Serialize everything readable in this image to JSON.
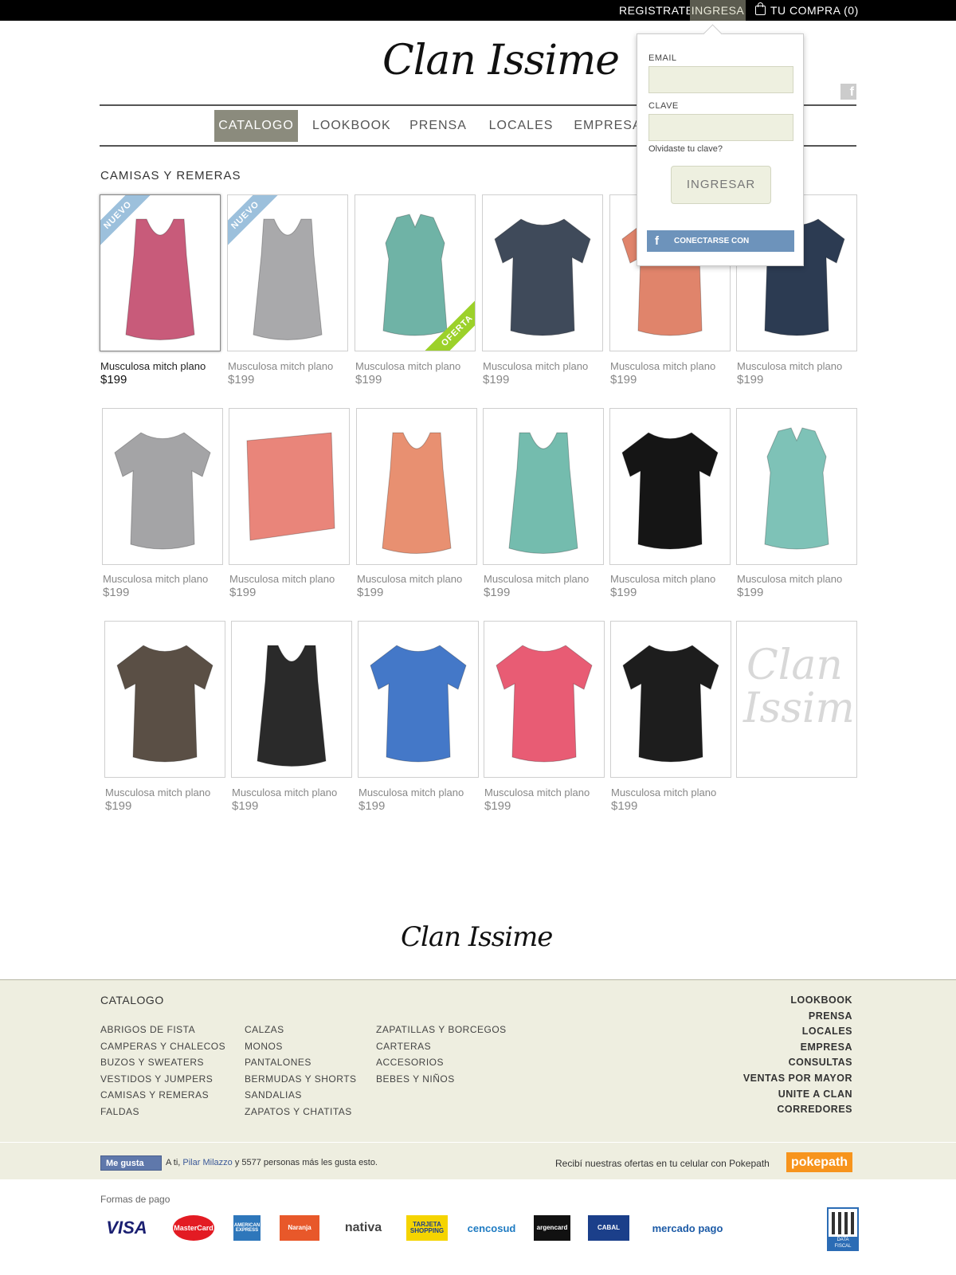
{
  "topbar": {
    "register": "REGISTRATE",
    "login": "INGRESA",
    "cart": "TU COMPRA (0)"
  },
  "logo": "Clan Issime",
  "nav": [
    "CATALOGO",
    "LOOKBOOK",
    "PRENSA",
    "LOCALES",
    "EMPRESA"
  ],
  "section_title": "CAMISAS Y REMERAS",
  "products": [
    {
      "name": "Musculosa mitch plano",
      "price": "$199",
      "badge": "NUEVO",
      "color": "#c85b7a",
      "shape": "tank"
    },
    {
      "name": "Musculosa mitch plano",
      "price": "$199",
      "badge": "NUEVO",
      "color": "#a9a9ab",
      "shape": "tank"
    },
    {
      "name": "Musculosa mitch plano",
      "price": "$199",
      "badge": "OFERTA",
      "color": "#6fb3a6",
      "shape": "sleeveless"
    },
    {
      "name": "Musculosa mitch plano",
      "price": "$199",
      "badge": "",
      "color": "#3f4a5a",
      "shape": "tee"
    },
    {
      "name": "Musculosa mitch plano",
      "price": "$199",
      "badge": "",
      "color": "#e0846b",
      "shape": "tee"
    },
    {
      "name": "Musculosa mitch plano",
      "price": "$199",
      "badge": "",
      "color": "#2c3b52",
      "shape": "tee"
    },
    {
      "name": "Musculosa mitch plano",
      "price": "$199",
      "badge": "",
      "color": "#a4a4a6",
      "shape": "tee"
    },
    {
      "name": "Musculosa mitch plano",
      "price": "$199",
      "badge": "",
      "color": "#e9857a",
      "shape": "folded"
    },
    {
      "name": "Musculosa mitch plano",
      "price": "$199",
      "badge": "",
      "color": "#e89071",
      "shape": "tank"
    },
    {
      "name": "Musculosa mitch plano",
      "price": "$199",
      "badge": "",
      "color": "#74bcae",
      "shape": "tank"
    },
    {
      "name": "Musculosa mitch plano",
      "price": "$199",
      "badge": "",
      "color": "#151515",
      "shape": "tee"
    },
    {
      "name": "Musculosa mitch plano",
      "price": "$199",
      "badge": "",
      "color": "#7ec2b7",
      "shape": "sleeveless"
    },
    {
      "name": "Musculosa mitch plano",
      "price": "$199",
      "badge": "",
      "color": "#5a4f45",
      "shape": "tee"
    },
    {
      "name": "Musculosa mitch plano",
      "price": "$199",
      "badge": "",
      "color": "#2a2a2a",
      "shape": "tank"
    },
    {
      "name": "Musculosa mitch plano",
      "price": "$199",
      "badge": "",
      "color": "#4478c8",
      "shape": "tee"
    },
    {
      "name": "Musculosa mitch plano",
      "price": "$199",
      "badge": "",
      "color": "#e85c74",
      "shape": "tee"
    },
    {
      "name": "Musculosa mitch plano",
      "price": "$199",
      "badge": "",
      "color": "#1d1d1d",
      "shape": "tee"
    }
  ],
  "placeholder_logo": [
    "Clan",
    "Issime"
  ],
  "login_popup": {
    "email_label": "EMAIL",
    "password_label": "CLAVE",
    "forgot": "Olvidaste tu clave?",
    "submit": "INGRESAR",
    "facebook": "CONECTARSE CON FACEBOOK"
  },
  "footer": {
    "catalog_title": "CATALOGO",
    "col1": [
      "ABRIGOS DE FISTA",
      "CAMPERAS Y CHALECOS",
      "BUZOS Y SWEATERS",
      "VESTIDOS Y JUMPERS",
      "CAMISAS Y REMERAS",
      "FALDAS"
    ],
    "col2": [
      "CALZAS",
      "MONOS",
      "PANTALONES",
      "BERMUDAS Y SHORTS",
      "SANDALIAS",
      "ZAPATOS Y CHATITAS"
    ],
    "col3": [
      "ZAPATILLAS Y BORCEGOS",
      "CARTERAS",
      "ACCESORIOS",
      "BEBES Y NIÑOS"
    ],
    "right_links": [
      "LOOKBOOK",
      "PRENSA",
      "LOCALES",
      "EMPRESA",
      "CONSULTAS",
      "VENTAS POR MAYOR",
      "UNITE A CLAN",
      "CORREDORES"
    ],
    "like_button": "Me gusta",
    "like_prefix": "A ti,",
    "like_name": "Pilar Milazzo",
    "like_suffix": "y 5577 personas más les gusta esto.",
    "pokepath_text": "Recibí nuestras ofertas en tu celular con Pokepath",
    "pokepath_logo": "pokepath",
    "payment_label": "Formas de pago",
    "payments": [
      "VISA",
      "MasterCard",
      "AMERICAN EXPRESS",
      "Naranja",
      "nativa",
      "TARJETA SHOPPING",
      "cencosud",
      "argencard",
      "CABAL",
      "mercado pago"
    ],
    "qr_label": "DATA FISCAL"
  },
  "colors": {
    "accent": "#8b8b7d",
    "footer_bg": "#eeeee0",
    "input_bg": "#eef0e0"
  }
}
